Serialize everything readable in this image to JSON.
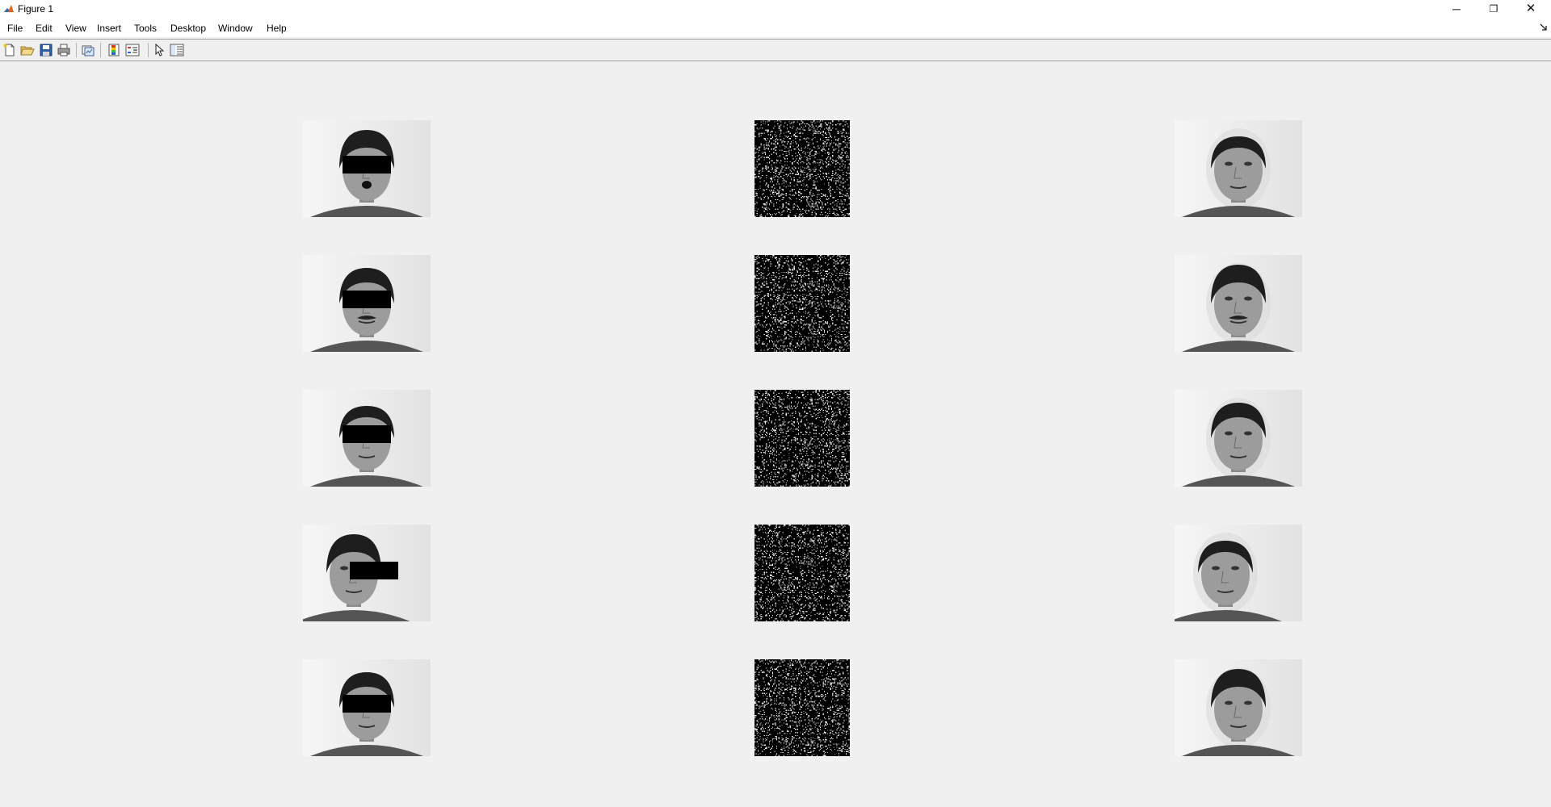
{
  "window": {
    "title": "Figure 1",
    "controls": {
      "minimize": "─",
      "maximize": "❐",
      "close": "✕"
    }
  },
  "menubar": {
    "items": [
      "File",
      "Edit",
      "View",
      "Insert",
      "Tools",
      "Desktop",
      "Window",
      "Help"
    ],
    "dock_icon": "dock-arrow-icon"
  },
  "toolbar": {
    "buttons": [
      "new-figure-icon",
      "open-file-icon",
      "save-icon",
      "print-icon",
      "link-plot-icon",
      "insert-colorbar-icon",
      "insert-legend-icon",
      "edit-plot-pointer-icon",
      "property-inspector-icon"
    ]
  },
  "figure": {
    "subplots": {
      "rows": 5,
      "columns": [
        "occluded-face-image",
        "sparse-noise-image",
        "reconstructed-face-image"
      ]
    }
  }
}
